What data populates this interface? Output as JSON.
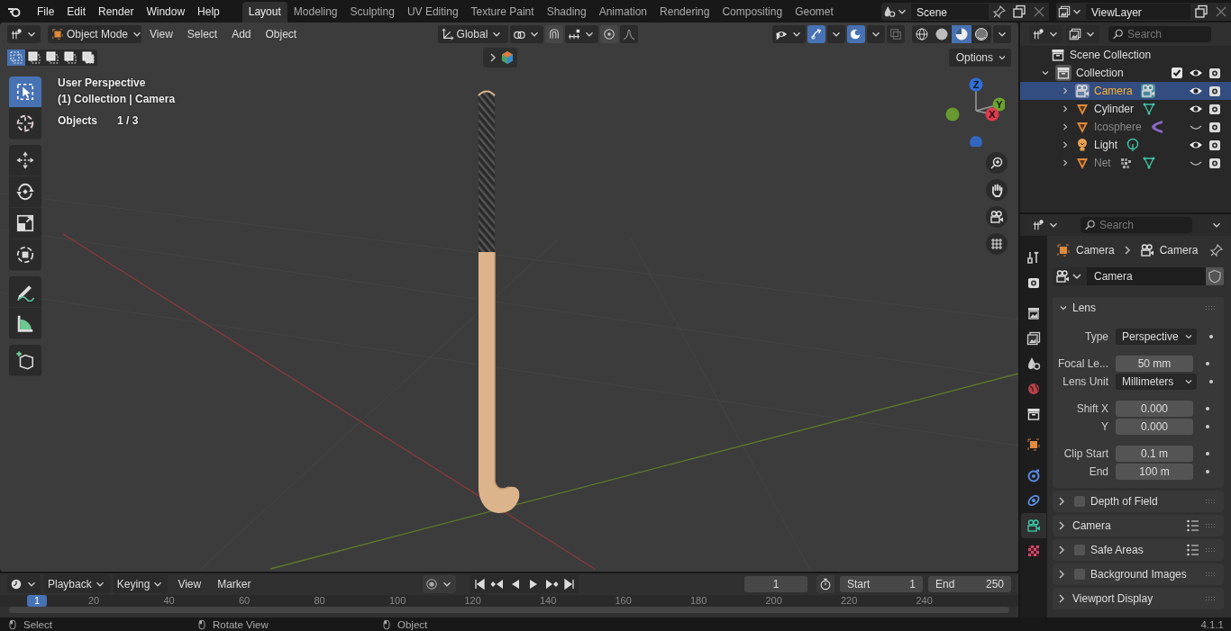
{
  "menu": [
    "File",
    "Edit",
    "Render",
    "Window",
    "Help"
  ],
  "workspaces": [
    {
      "label": "Layout",
      "selected": true
    },
    {
      "label": "Modeling",
      "selected": false
    },
    {
      "label": "Sculpting",
      "selected": false
    },
    {
      "label": "UV Editing",
      "selected": false
    },
    {
      "label": "Texture Paint",
      "selected": false
    },
    {
      "label": "Shading",
      "selected": false
    },
    {
      "label": "Animation",
      "selected": false
    },
    {
      "label": "Rendering",
      "selected": false
    },
    {
      "label": "Compositing",
      "selected": false
    },
    {
      "label": "Geomet",
      "selected": false
    }
  ],
  "scene": "Scene",
  "view_layer": "ViewLayer",
  "viewport": {
    "mode": "Object Mode",
    "menus": [
      "View",
      "Select",
      "Add",
      "Object"
    ],
    "orientation": "Global",
    "options": "Options",
    "select_modes": [
      {
        "kind": "set",
        "selected": true
      },
      {
        "kind": "extend",
        "selected": false
      },
      {
        "kind": "subtract",
        "selected": false
      },
      {
        "kind": "difference",
        "selected": false
      },
      {
        "kind": "intersect",
        "selected": false
      }
    ],
    "gizmos_on": true,
    "overlays_on": true,
    "shading": [
      {
        "kind": "wireframe",
        "selected": false
      },
      {
        "kind": "solid",
        "selected": false
      },
      {
        "kind": "material",
        "selected": true
      },
      {
        "kind": "rendered",
        "selected": false
      }
    ],
    "view_name": "User Perspective",
    "context": "(1) Collection | Camera",
    "objects_label": "Objects",
    "objects_count": "1 / 3",
    "axes": [
      {
        "label": "Z",
        "color": "#2f6fd6"
      },
      {
        "label": "Y",
        "color": "#6ba32c"
      },
      {
        "label": "X",
        "color": "#e0394d"
      }
    ],
    "tool_groups": [
      [
        {
          "kind": "select",
          "selected": true
        },
        {
          "kind": "cursor",
          "selected": false
        }
      ],
      [
        {
          "kind": "move",
          "selected": false
        },
        {
          "kind": "rotate",
          "selected": false
        },
        {
          "kind": "scale",
          "selected": false
        },
        {
          "kind": "transform",
          "selected": false
        }
      ],
      [
        {
          "kind": "annotate",
          "selected": false
        },
        {
          "kind": "measure",
          "selected": false
        }
      ],
      [
        {
          "kind": "add_cube",
          "selected": false
        }
      ]
    ]
  },
  "outliner": {
    "search": {
      "placeholder": "Search"
    },
    "root": "Scene Collection",
    "collection": {
      "name": "Collection",
      "checked": true,
      "expanded": true,
      "children": [
        {
          "name": "Camera",
          "kind": "camera",
          "selected": true,
          "visible": true,
          "data": [
            {
              "kind": "camera_data"
            }
          ]
        },
        {
          "name": "Cylinder",
          "kind": "mesh",
          "selected": false,
          "visible": true,
          "data": [
            {
              "kind": "mesh_data"
            }
          ]
        },
        {
          "name": "Icosphere",
          "kind": "mesh",
          "selected": false,
          "visible": false,
          "data": [
            {
              "kind": "arc"
            }
          ]
        },
        {
          "name": "Light",
          "kind": "light",
          "selected": false,
          "visible": true,
          "data": [
            {
              "kind": "light_data"
            }
          ]
        },
        {
          "name": "Net",
          "kind": "mesh",
          "selected": false,
          "visible": false,
          "data": [
            {
              "kind": "particles"
            },
            {
              "kind": "mesh_data"
            }
          ]
        }
      ]
    }
  },
  "properties": {
    "search": {
      "placeholder": "Search"
    },
    "tabs": [
      {
        "kind": "tool",
        "selected": false
      },
      {
        "kind": "render",
        "selected": false
      },
      {
        "kind": "output",
        "selected": false
      },
      {
        "kind": "view_layer",
        "selected": false
      },
      {
        "kind": "scene",
        "selected": false
      },
      {
        "kind": "world",
        "selected": false
      },
      {
        "kind": "collection",
        "selected": false
      },
      {
        "kind": "object",
        "selected": false
      },
      {
        "kind": "physics",
        "selected": false
      },
      {
        "kind": "constraints",
        "selected": false
      },
      {
        "kind": "camera_data",
        "selected": true
      },
      {
        "kind": "texture",
        "selected": false
      }
    ],
    "breadcrumb": [
      "Camera",
      "Camera"
    ],
    "datablock": "Camera",
    "lens": {
      "title": "Lens",
      "expanded": true,
      "groups": [
        [
          {
            "label": "Type",
            "value": "Perspective",
            "kind": "dropdown"
          }
        ],
        [
          {
            "label": "Focal Le...",
            "value": "50 mm",
            "kind": "number"
          },
          {
            "label": "Lens Unit",
            "value": "Millimeters",
            "kind": "dropdown"
          }
        ],
        [
          {
            "label": "Shift X",
            "value": "0.000",
            "kind": "number"
          },
          {
            "label": "Y",
            "value": "0.000",
            "kind": "number"
          }
        ],
        [
          {
            "label": "Clip Start",
            "value": "0.1 m",
            "kind": "number"
          },
          {
            "label": "End",
            "value": "100 m",
            "kind": "number"
          }
        ]
      ]
    },
    "panels": [
      {
        "title": "Depth of Field",
        "kind": "checkbox",
        "checked": false,
        "presets": false
      },
      {
        "title": "Camera",
        "kind": "plain",
        "presets": true
      },
      {
        "title": "Safe Areas",
        "kind": "checkbox",
        "checked": false,
        "presets": true
      },
      {
        "title": "Background Images",
        "kind": "checkbox",
        "checked": false,
        "presets": false
      },
      {
        "title": "Viewport Display",
        "kind": "plain",
        "presets": false
      }
    ]
  },
  "timeline": {
    "menus": [
      "Playback",
      "Keying",
      "View",
      "Marker"
    ],
    "current_frame": "1",
    "start_label": "Start",
    "start": "1",
    "end_label": "End",
    "end": "250",
    "playhead": "1",
    "ticks": [
      "20",
      "40",
      "60",
      "80",
      "100",
      "120",
      "140",
      "160",
      "180",
      "200",
      "220",
      "240"
    ]
  },
  "status": [
    "Select",
    "Rotate View",
    "Object"
  ],
  "version": "4.1.1"
}
